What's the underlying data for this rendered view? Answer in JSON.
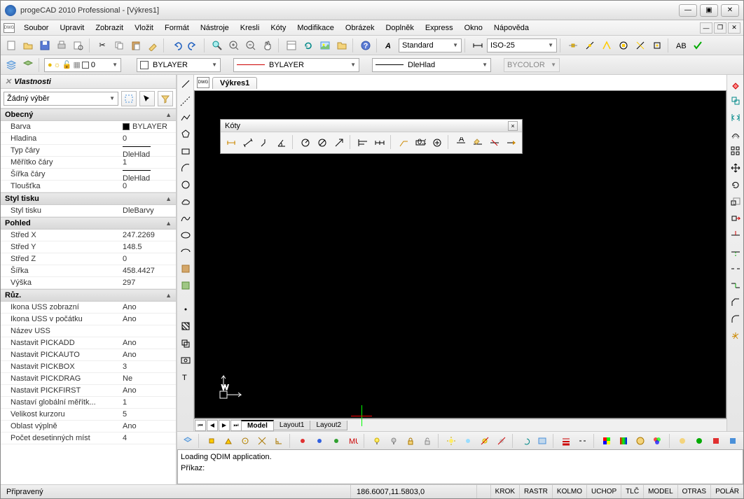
{
  "window": {
    "title": "progeCAD 2010 Professional - [Výkres1]"
  },
  "menu": [
    "Soubor",
    "Upravit",
    "Zobrazit",
    "Vložit",
    "Formát",
    "Nástroje",
    "Kresli",
    "Kóty",
    "Modifikace",
    "Obrázek",
    "Doplněk",
    "Express",
    "Okno",
    "Nápověda"
  ],
  "layerCombo": "0",
  "textStyle": "Standard",
  "dimStyle": "ISO-25",
  "colorBylayer": "BYLAYER",
  "ltBylayer": "BYLAYER",
  "lwDle": "DleHlad",
  "bycolor": "BYCOLOR",
  "selection": "Žádný výběr",
  "panels": {
    "title": "Vlastnosti",
    "obecny": "Obecný",
    "stylTisku": "Styl tisku",
    "pohled": "Pohled",
    "ruz": "Růz."
  },
  "props": {
    "barva": {
      "k": "Barva",
      "v": "BYLAYER"
    },
    "hladina": {
      "k": "Hladina",
      "v": "0"
    },
    "typCary": {
      "k": "Typ čáry",
      "v": "DleHlad"
    },
    "meritko": {
      "k": "Měřítko čáry",
      "v": "1"
    },
    "sirka": {
      "k": "Šířka čáry",
      "v": "DleHlad"
    },
    "tloustka": {
      "k": "Tloušťka",
      "v": "0"
    },
    "stylTisku": {
      "k": "Styl tisku",
      "v": "DleBarvy"
    },
    "stredX": {
      "k": "Střed X",
      "v": "247.2269"
    },
    "stredY": {
      "k": "Střed Y",
      "v": "148.5"
    },
    "stredZ": {
      "k": "Střed Z",
      "v": "0"
    },
    "sirkaV": {
      "k": "Šířka",
      "v": "458.4427"
    },
    "vyska": {
      "k": "Výška",
      "v": "297"
    },
    "ussZobr": {
      "k": "Ikona USS zobrazní",
      "v": "Ano"
    },
    "ussPoc": {
      "k": "Ikona USS v počátku",
      "v": "Ano"
    },
    "nazevUss": {
      "k": "Název USS",
      "v": ""
    },
    "pickadd": {
      "k": "Nastavit PICKADD",
      "v": "Ano"
    },
    "pickauto": {
      "k": "Nastavit PICKAUTO",
      "v": "Ano"
    },
    "pickbox": {
      "k": "Nastavit PICKBOX",
      "v": "3"
    },
    "pickdrag": {
      "k": "Nastavit PICKDRAG",
      "v": "Ne"
    },
    "pickfirst": {
      "k": "Nastavit PICKFIRST",
      "v": "Ano"
    },
    "globMer": {
      "k": "Nastaví globální měřítk...",
      "v": "1"
    },
    "velKurz": {
      "k": "Velikost kurzoru",
      "v": "5"
    },
    "oblVypl": {
      "k": "Oblast výplně",
      "v": "Ano"
    },
    "pocDes": {
      "k": "Počet desetinných míst",
      "v": "4"
    }
  },
  "docTab": "Výkres1",
  "koty": "Kóty",
  "layouts": {
    "model": "Model",
    "l1": "Layout1",
    "l2": "Layout2"
  },
  "cmd": {
    "line1": "Loading QDIM application.",
    "line2": "Příkaz:"
  },
  "status": {
    "ready": "Připravený",
    "coords": "186.6007,11.5803,0",
    "toggles": [
      "KROK",
      "RASTR",
      "KOLMO",
      "UCHOP",
      "TLČ",
      "MODEL",
      "OTRAS",
      "POLÁR"
    ]
  }
}
